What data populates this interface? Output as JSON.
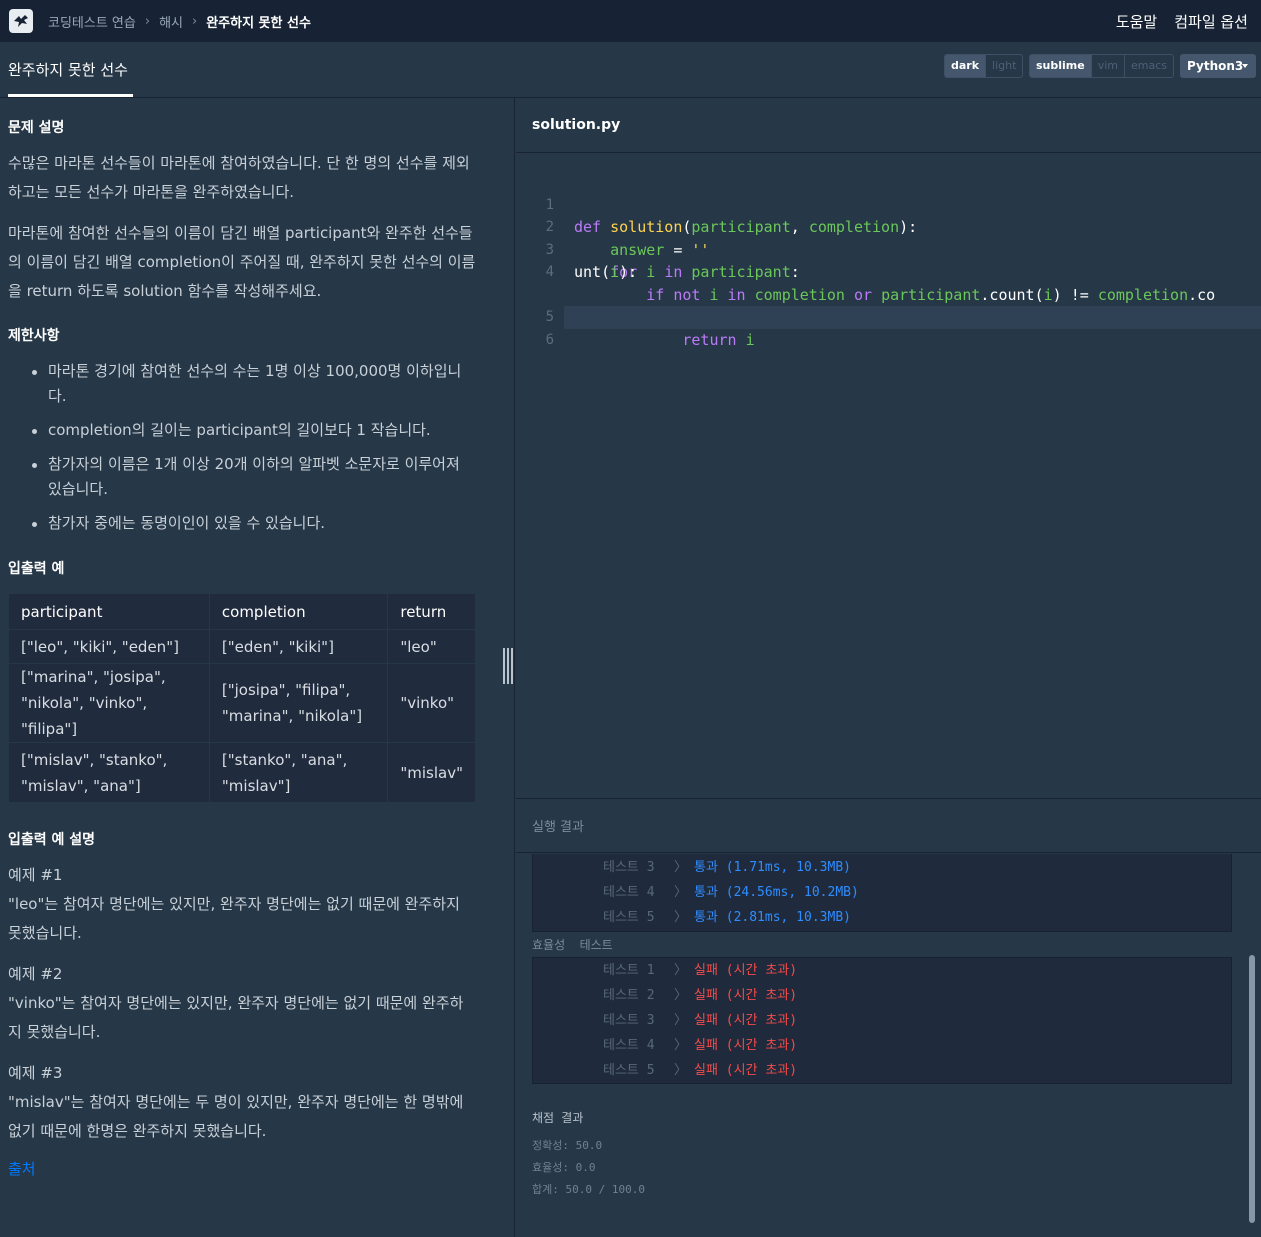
{
  "nav": {
    "breadcrumbs": [
      "코딩테스트 연습",
      "해시",
      "완주하지 못한 선수"
    ],
    "help": "도움말",
    "compile_options": "컴파일 옵션"
  },
  "tab": {
    "title": "완주하지 못한 선수",
    "theme": {
      "dark": "dark",
      "light": "light",
      "selected": "dark"
    },
    "keymap": {
      "sublime": "sublime",
      "vim": "vim",
      "emacs": "emacs",
      "selected": "sublime"
    },
    "language": "Python3"
  },
  "problem": {
    "desc_heading": "문제 설명",
    "desc_p1": "수많은 마라톤 선수들이 마라톤에 참여하였습니다. 단 한 명의 선수를 제외하고는 모든 선수가 마라톤을 완주하였습니다.",
    "desc_p2": "마라톤에 참여한 선수들의 이름이 담긴 배열 participant와 완주한 선수들의 이름이 담긴 배열 completion이 주어질 때, 완주하지 못한 선수의 이름을 return 하도록 solution 함수를 작성해주세요.",
    "constraints_heading": "제한사항",
    "constraints": [
      "마라톤 경기에 참여한 선수의 수는 1명 이상 100,000명 이하입니다.",
      "completion의 길이는 participant의 길이보다 1 작습니다.",
      "참가자의 이름은 1개 이상 20개 이하의 알파벳 소문자로 이루어져 있습니다.",
      "참가자 중에는 동명이인이 있을 수 있습니다."
    ],
    "io_heading": "입출력 예",
    "io_headers": [
      "participant",
      "completion",
      "return"
    ],
    "io_rows": [
      [
        "[\"leo\", \"kiki\", \"eden\"]",
        "[\"eden\", \"kiki\"]",
        "\"leo\""
      ],
      [
        "[\"marina\", \"josipa\", \"nikola\", \"vinko\", \"filipa\"]",
        "[\"josipa\", \"filipa\", \"marina\", \"nikola\"]",
        "\"vinko\""
      ],
      [
        "[\"mislav\", \"stanko\", \"mislav\", \"ana\"]",
        "[\"stanko\", \"ana\", \"mislav\"]",
        "\"mislav\""
      ]
    ],
    "io_desc_heading": "입출력 예 설명",
    "examples": [
      {
        "title": "예제 #1",
        "text": "\"leo\"는 참여자 명단에는 있지만, 완주자 명단에는 없기 때문에 완주하지 못했습니다."
      },
      {
        "title": "예제 #2",
        "text": "\"vinko\"는 참여자 명단에는 있지만, 완주자 명단에는 없기 때문에 완주하지 못했습니다."
      },
      {
        "title": "예제 #3",
        "text": "\"mislav\"는 참여자 명단에는 두 명이 있지만, 완주자 명단에는 한 명밖에 없기 때문에 한명은 완주하지 못했습니다."
      }
    ],
    "source_link": "출처"
  },
  "editor": {
    "filename": "solution.py",
    "line_numbers": [
      "1",
      "2",
      "3",
      "4",
      "5",
      "6"
    ],
    "lines": [
      "def solution(participant, completion):",
      "    answer = ''",
      "    for i in participant:",
      "        if not i in completion or participant.count(i) != completion.count(i):",
      "            return i",
      ""
    ]
  },
  "results": {
    "title": "실행 결과",
    "accuracy_tests": [
      {
        "name": "테스트 3",
        "result": "통과 (1.71ms, 10.3MB)"
      },
      {
        "name": "테스트 4",
        "result": "통과 (24.56ms, 10.2MB)"
      },
      {
        "name": "테스트 5",
        "result": "통과 (2.81ms, 10.3MB)"
      }
    ],
    "efficiency_label": "효율성  테스트",
    "efficiency_tests": [
      {
        "name": "테스트 1",
        "result": "실패 (시간 초과)"
      },
      {
        "name": "테스트 2",
        "result": "실패 (시간 초과)"
      },
      {
        "name": "테스트 3",
        "result": "실패 (시간 초과)"
      },
      {
        "name": "테스트 4",
        "result": "실패 (시간 초과)"
      },
      {
        "name": "테스트 5",
        "result": "실패 (시간 초과)"
      }
    ],
    "score_heading": "채점 결과",
    "accuracy": "정확성: 50.0",
    "efficiency": "효율성: 0.0",
    "total": "합계: 50.0 / 100.0"
  },
  "colors": {
    "pass": "#2f8cff",
    "fail": "#f44a4a",
    "link": "#0078ff",
    "background": "#263747",
    "nav": "#172334"
  }
}
